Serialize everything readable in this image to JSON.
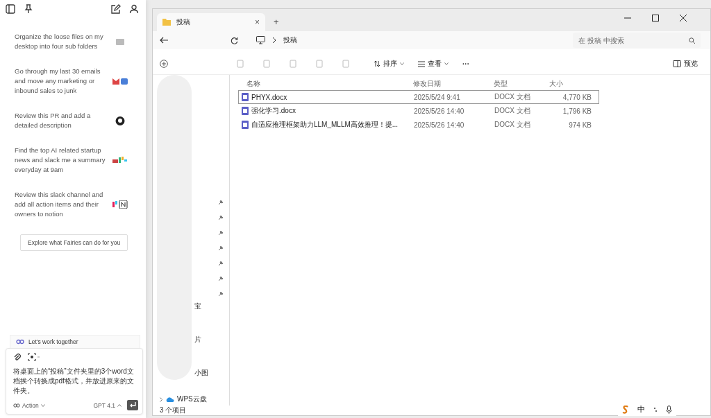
{
  "assistant_panel": {
    "suggestions": [
      {
        "text": "Organize the loose files on my desktop into four sub folders",
        "kind": "folder"
      },
      {
        "text": "Go through my last 30 emails and move any marketing or inbound sales to junk",
        "kind": "mail"
      },
      {
        "text": "Review this PR and add a detailed description",
        "kind": "github"
      },
      {
        "text": "Find the top AI related startup news and slack me a summary everyday at 9am",
        "kind": "slack"
      },
      {
        "text": "Review this slack channel and add all action items and their owners to notion",
        "kind": "notion"
      }
    ],
    "explore_button": "Explore what Fairies can do for you",
    "collab_label": "Let's work together",
    "prompt": "将桌面上的“投稿”文件夹里的3个word文档挨个转换成pdf格式，并放进原来的文件夹。",
    "action_button": "Action",
    "model_button": "GPT 4.1"
  },
  "explorer": {
    "tab": {
      "title": "投稿",
      "close": "×",
      "new_tab": "+"
    },
    "breadcrumb": [
      "投稿"
    ],
    "search": {
      "placeholder": "在 投稿 中搜索"
    },
    "toolbar": {
      "sort": "排序",
      "view": "查看",
      "more": "···",
      "preview": "预览"
    },
    "nav_fragments": [
      "宝",
      "片",
      "小图"
    ],
    "nav_cloud": "WPS云盘",
    "columns": [
      "名称",
      "修改日期",
      "类型",
      "大小"
    ],
    "rows": [
      {
        "name": "PHYX.docx",
        "date": "2025/5/24 9:41",
        "type": "DOCX 文档",
        "size": "4,770 KB",
        "selected": true
      },
      {
        "name": "强化学习.docx",
        "date": "2025/5/26 14:40",
        "type": "DOCX 文档",
        "size": "1,796 KB",
        "selected": false
      },
      {
        "name": "自适应推理框架助力LLM_MLLM高效推理！提...",
        "date": "2025/5/26 14:40",
        "type": "DOCX 文档",
        "size": "974 KB",
        "selected": false
      }
    ],
    "status_bar": "3 个项目"
  },
  "taskbar": {
    "ime": "中"
  }
}
